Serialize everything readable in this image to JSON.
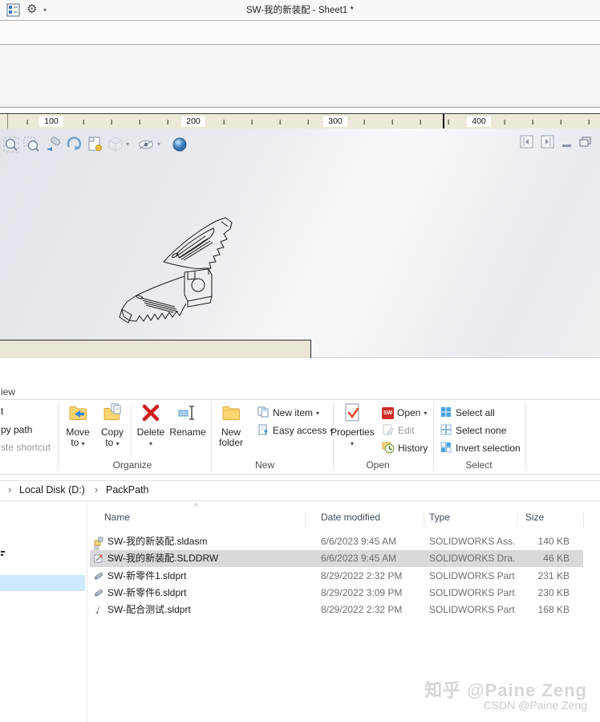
{
  "icons": {
    "gear": "⚙",
    "dropdown_caret": "▾",
    "breadcrumb_chevron": "›",
    "sort_caret": "^",
    "sw_logo": "SW"
  },
  "solidworks": {
    "title": "SW-我的新装配 - Sheet1 *",
    "ruler": {
      "labels": [
        "100",
        "200",
        "300",
        "400"
      ]
    }
  },
  "explorer": {
    "ribbon": {
      "view_tab_partial": "iew",
      "cut_partial": "t",
      "copy_path_partial": "py path",
      "paste_shortcut_partial": "ste shortcut",
      "move_to_line1": "Move",
      "move_to_line2": "to",
      "copy_to_line1": "Copy",
      "copy_to_line2": "to",
      "delete": "Delete",
      "rename": "Rename",
      "new_folder_line1": "New",
      "new_folder_line2": "folder",
      "new_item": "New item",
      "easy_access": "Easy access",
      "properties": "Properties",
      "open": "Open",
      "edit": "Edit",
      "history": "History",
      "select_all": "Select all",
      "select_none": "Select none",
      "invert_selection": "Invert selection",
      "groups": {
        "organize": "Organize",
        "new": "New",
        "open": "Open",
        "select": "Select"
      }
    },
    "breadcrumb": {
      "item1": "Local Disk (D:)",
      "item2": "PackPath"
    },
    "columns": {
      "name": "Name",
      "date": "Date modified",
      "type": "Type",
      "size": "Size"
    },
    "files": [
      {
        "name": "SW-我的新装配.sldasm",
        "date": "6/6/2023 9:45 AM",
        "type": "SOLIDWORKS Ass...",
        "size": "140 KB"
      },
      {
        "name": "SW-我的新装配.SLDDRW",
        "date": "6/6/2023 9:45 AM",
        "type": "SOLIDWORKS Dra...",
        "size": "46 KB"
      },
      {
        "name": "SW-新零件1.sldprt",
        "date": "8/29/2022 2:32 PM",
        "type": "SOLIDWORKS Part...",
        "size": "231 KB"
      },
      {
        "name": "SW-新零件6.sldprt",
        "date": "8/29/2022 3:09 PM",
        "type": "SOLIDWORKS Part...",
        "size": "230 KB"
      },
      {
        "name": "SW-配合测试.sldprt",
        "date": "8/29/2022 2:32 PM",
        "type": "SOLIDWORKS Part...",
        "size": "168 KB"
      }
    ]
  },
  "watermark": {
    "line1": "知乎 @Paine Zeng",
    "line2": "CSDN @Paine Zeng"
  },
  "colors": {
    "folder_yellow": "#f7d064",
    "delete_red": "#d11f1f",
    "sw_red": "#cf2e26",
    "selection_blue": "#cde8ff",
    "selected_row_gray": "#d9d9d9",
    "ruler_beige": "#ece9d8",
    "accent_blue": "#3a96dd"
  }
}
